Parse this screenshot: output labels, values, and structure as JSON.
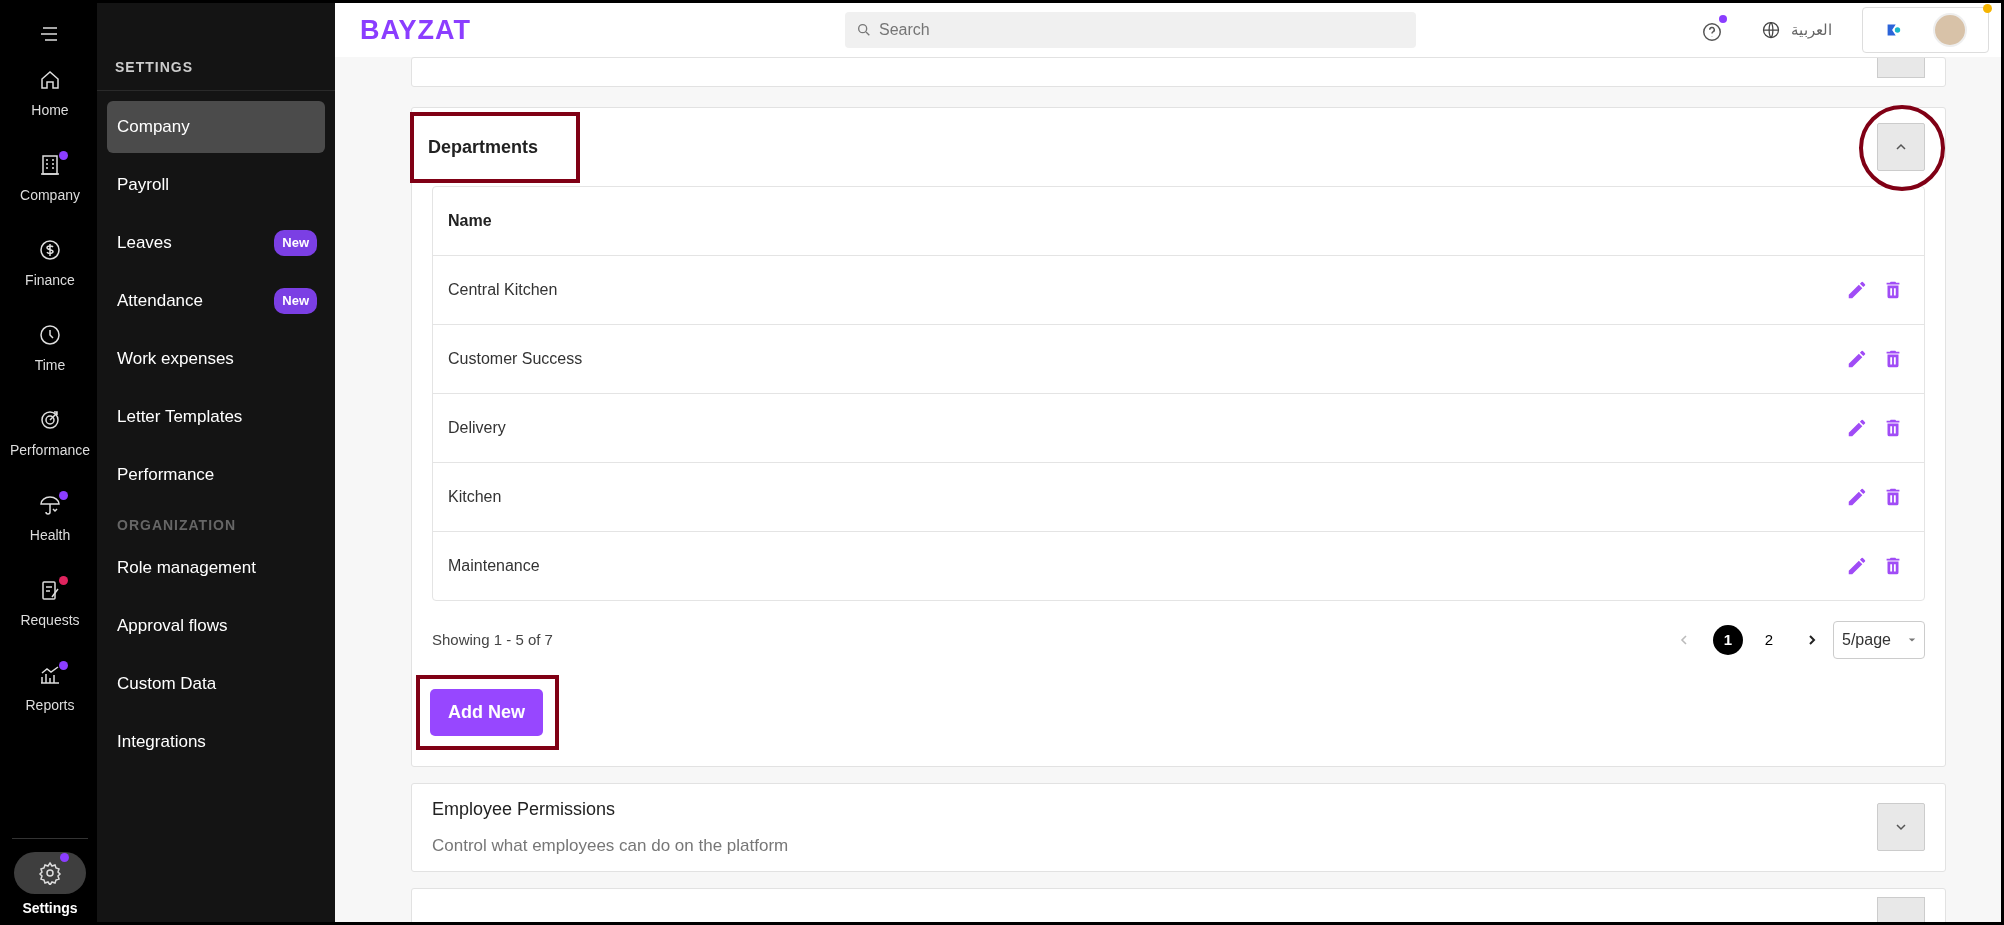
{
  "rail": {
    "items": [
      {
        "label": "Home"
      },
      {
        "label": "Company",
        "color": "#8b3dff"
      },
      {
        "label": "Finance"
      },
      {
        "label": "Time"
      },
      {
        "label": "Performance"
      },
      {
        "label": "Health",
        "color": "#8b3dff"
      },
      {
        "label": "Requests",
        "color": "#e0245e"
      },
      {
        "label": "Reports",
        "color": "#8b3dff"
      }
    ],
    "settings": {
      "label": "Settings",
      "selected": true,
      "color": "#8b3dff"
    }
  },
  "sidebar": {
    "sections": [
      {
        "heading": "SETTINGS",
        "items": [
          {
            "label": "Company",
            "selected": true
          },
          {
            "label": "Payroll",
            "selected": false
          },
          {
            "label": "Leaves",
            "selected": false,
            "badge": "New"
          },
          {
            "label": "Attendance",
            "selected": false,
            "badge": "New"
          },
          {
            "label": "Work expenses",
            "selected": false
          },
          {
            "label": "Letter Templates",
            "selected": false
          },
          {
            "label": "Performance",
            "selected": false
          }
        ]
      },
      {
        "heading": "ORGANIZATION",
        "items": [
          {
            "label": "Role management",
            "selected": false
          },
          {
            "label": "Approval flows",
            "selected": false
          },
          {
            "label": "Custom Data",
            "selected": false
          },
          {
            "label": "Integrations",
            "selected": false
          }
        ]
      }
    ]
  },
  "top_bar": {
    "logo": "BAYZAT",
    "search": {
      "placeholder": "Search"
    },
    "language": "العربية"
  },
  "departments": {
    "title": "Departments",
    "title_highlighted": true,
    "expanded": true,
    "toggle_highlighted": true,
    "columns": [
      "Name"
    ],
    "rows": [
      {
        "name": "Central Kitchen"
      },
      {
        "name": "Customer Success"
      },
      {
        "name": "Delivery"
      },
      {
        "name": "Kitchen"
      },
      {
        "name": "Maintenance"
      }
    ],
    "summary": "Showing 1 - 5 of 7",
    "pages": [
      {
        "label": "1",
        "selected": true
      },
      {
        "label": "2",
        "selected": false
      }
    ],
    "page_size": "5/page",
    "add_button": {
      "label": "Add New",
      "highlighted": true
    }
  },
  "sections": [
    {
      "title": "Employee Permissions",
      "subtitle": "Control what employees can do on the platform",
      "expanded": false
    }
  ]
}
